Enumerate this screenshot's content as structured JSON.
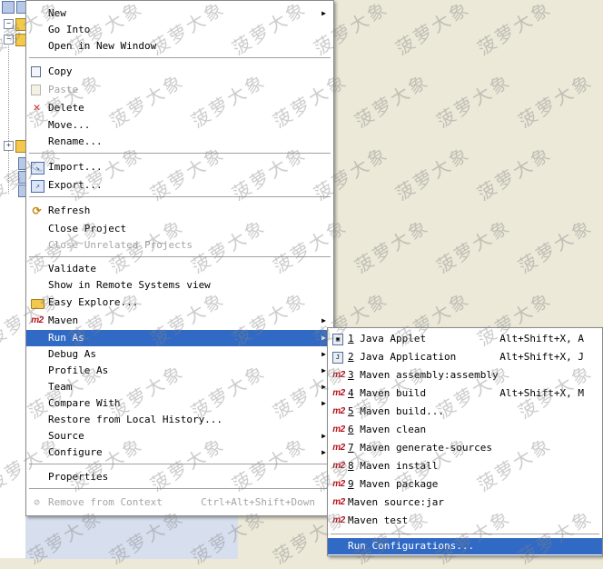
{
  "context_menu": {
    "items": [
      {
        "label": "New",
        "arrow": true
      },
      {
        "label": "Go Into"
      },
      {
        "label": "Open in New Window"
      },
      {
        "label": "Copy",
        "icon": "copy-icon"
      },
      {
        "label": "Paste",
        "icon": "paste-icon",
        "disabled": true
      },
      {
        "label": "Delete",
        "icon": "delete-icon"
      },
      {
        "label": "Move..."
      },
      {
        "label": "Rename..."
      },
      {
        "label": "Import...",
        "icon": "import-icon"
      },
      {
        "label": "Export...",
        "icon": "export-icon"
      },
      {
        "label": "Refresh",
        "icon": "refresh-icon"
      },
      {
        "label": "Close Project"
      },
      {
        "label": "Close Unrelated Projects",
        "disabled": true
      },
      {
        "label": "Validate"
      },
      {
        "label": "Show in Remote Systems view"
      },
      {
        "label": "Easy Explore...",
        "icon": "folder-icon"
      },
      {
        "label": "Maven",
        "icon": "maven-icon",
        "icon_text": "m2",
        "arrow": true
      },
      {
        "label": "Run As",
        "arrow": true,
        "highlighted": true
      },
      {
        "label": "Debug As",
        "arrow": true
      },
      {
        "label": "Profile As",
        "arrow": true
      },
      {
        "label": "Team",
        "arrow": true
      },
      {
        "label": "Compare With",
        "arrow": true
      },
      {
        "label": "Restore from Local History..."
      },
      {
        "label": "Source",
        "arrow": true
      },
      {
        "label": "Configure",
        "arrow": true
      },
      {
        "label": "Properties"
      },
      {
        "label": "Remove from Context",
        "accel": "Ctrl+Alt+Shift+Down",
        "icon": "remove-context-icon",
        "disabled": true
      }
    ]
  },
  "run_as_submenu": {
    "items": [
      {
        "num": "1",
        "label": "Java Applet",
        "accel": "Alt+Shift+X, A",
        "icon": "java-applet-icon"
      },
      {
        "num": "2",
        "label": "Java Application",
        "accel": "Alt+Shift+X, J",
        "icon": "java-application-icon",
        "icon_text": "J"
      },
      {
        "num": "3",
        "label": "Maven assembly:assembly",
        "icon": "maven-icon",
        "icon_text": "m2"
      },
      {
        "num": "4",
        "label": "Maven build",
        "accel": "Alt+Shift+X, M",
        "icon": "maven-icon",
        "icon_text": "m2"
      },
      {
        "num": "5",
        "label": "Maven build...",
        "icon": "maven-icon",
        "icon_text": "m2"
      },
      {
        "num": "6",
        "label": "Maven clean",
        "icon": "maven-icon",
        "icon_text": "m2"
      },
      {
        "num": "7",
        "label": "Maven generate-sources",
        "icon": "maven-icon",
        "icon_text": "m2"
      },
      {
        "num": "8",
        "label": "Maven install",
        "icon": "maven-icon",
        "icon_text": "m2"
      },
      {
        "num": "9",
        "label": "Maven package",
        "icon": "maven-icon",
        "icon_text": "m2"
      },
      {
        "num": "",
        "label": "Maven source:jar",
        "icon": "maven-icon",
        "icon_text": "m2"
      },
      {
        "num": "",
        "label": "Maven test",
        "icon": "maven-icon",
        "icon_text": "m2"
      },
      {
        "num": "",
        "label": "Run Configurations...",
        "highlighted": true
      }
    ]
  },
  "watermark_text": "菠萝大象",
  "colors": {
    "highlight": "#316ac5",
    "maven": "#b5121b",
    "desktop": "#ece9d8"
  }
}
